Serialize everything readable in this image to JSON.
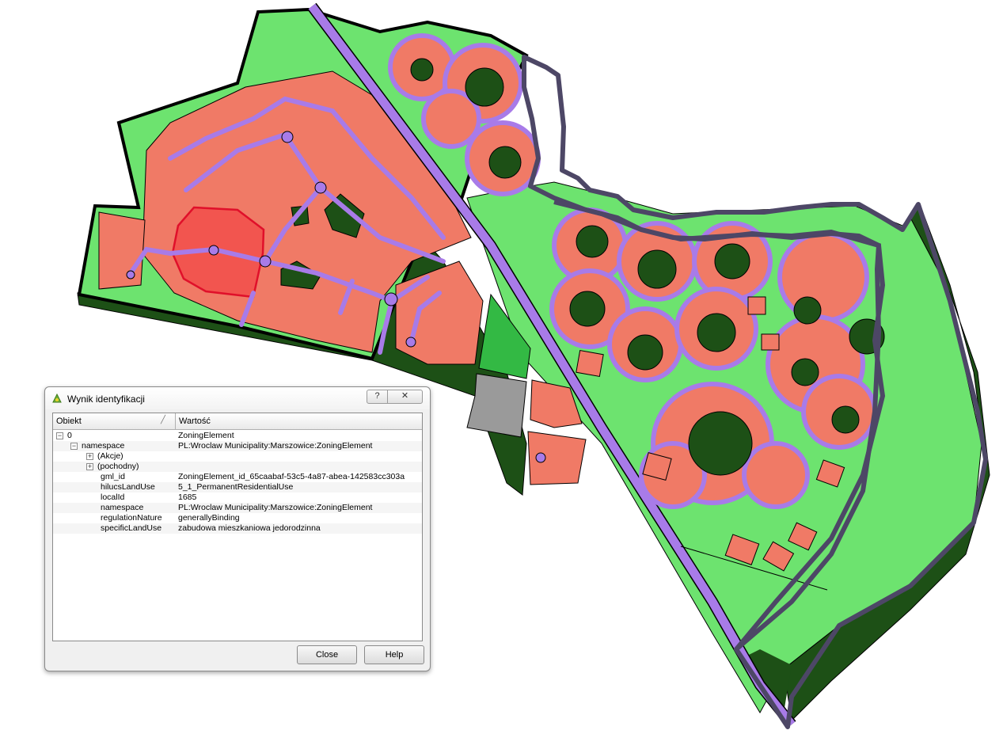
{
  "dialog": {
    "title": "Wynik identyfikacji",
    "help_btn": "?",
    "close_btn": "✕",
    "columns": {
      "object": "Obiekt",
      "value": "Wartość"
    },
    "rows": [
      {
        "key": "0",
        "value": "ZoningElement",
        "indent": 0,
        "expander": "−"
      },
      {
        "key": "namespace",
        "value": "PL:Wroclaw Municipality:Marszowice:ZoningElement",
        "indent": 1,
        "expander": "−"
      },
      {
        "key": "(Akcje)",
        "value": "",
        "indent": 2,
        "expander": "+"
      },
      {
        "key": "(pochodny)",
        "value": "",
        "indent": 2,
        "expander": "+"
      },
      {
        "key": "gml_id",
        "value": "ZoningElement_id_65caabaf-53c5-4a87-abea-142583cc303a",
        "indent": 3,
        "expander": ""
      },
      {
        "key": "hilucsLandUse",
        "value": "5_1_PermanentResidentialUse",
        "indent": 3,
        "expander": ""
      },
      {
        "key": "localId",
        "value": "1685",
        "indent": 3,
        "expander": ""
      },
      {
        "key": "namespace",
        "value": "PL:Wroclaw Municipality:Marszowice:ZoningElement",
        "indent": 3,
        "expander": ""
      },
      {
        "key": "regulationNature",
        "value": "generallyBinding",
        "indent": 3,
        "expander": ""
      },
      {
        "key": "specificLandUse",
        "value": "zabudowa mieszkaniowa jedorodzinna",
        "indent": 3,
        "expander": ""
      }
    ],
    "close_label": "Close",
    "help_label": "Help"
  },
  "colors": {
    "light_green": "#6de36f",
    "dark_green": "#1d5016",
    "salmon": "#f07a66",
    "selected": "#f2554f",
    "road": "#a87be8",
    "bright_green": "#33b944",
    "grey": "#9a9a9a",
    "boundary": "#4d4766"
  }
}
